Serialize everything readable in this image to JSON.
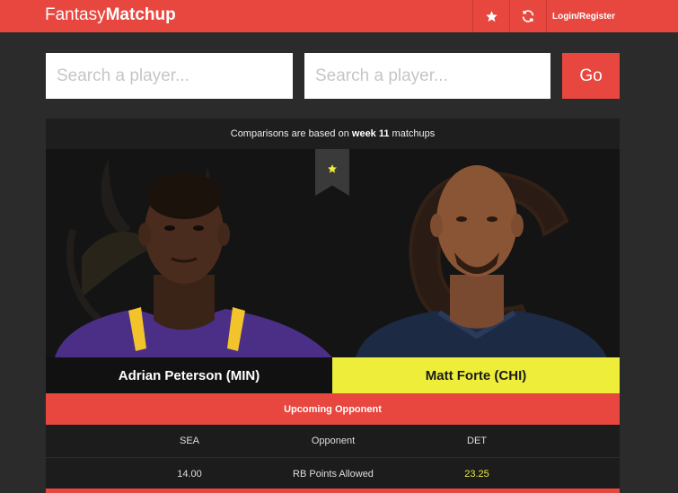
{
  "header": {
    "brand_light": "Fantasy",
    "brand_bold": "Matchup",
    "login_label": "Login/Register",
    "icons": [
      "star-icon",
      "refresh-icon"
    ]
  },
  "search": {
    "player1_placeholder": "Search a player...",
    "player2_placeholder": "Search a player...",
    "go_label": "Go"
  },
  "comparison": {
    "note_prefix": "Comparisons are based on ",
    "note_week": "week 11",
    "note_suffix": " matchups",
    "player1": {
      "name": "Adrian Peterson (MIN)"
    },
    "player2": {
      "name": "Matt Forte (CHI)"
    },
    "section_title": "Upcoming Opponent",
    "rows": [
      {
        "left": "SEA",
        "label": "Opponent",
        "right": "DET"
      },
      {
        "left": "14.00",
        "label": "RB Points Allowed",
        "right": "23.25"
      }
    ]
  },
  "colors": {
    "accent": "#e8473f",
    "highlight": "#eded3a",
    "background": "#2b2b2b",
    "panel": "#161616"
  }
}
